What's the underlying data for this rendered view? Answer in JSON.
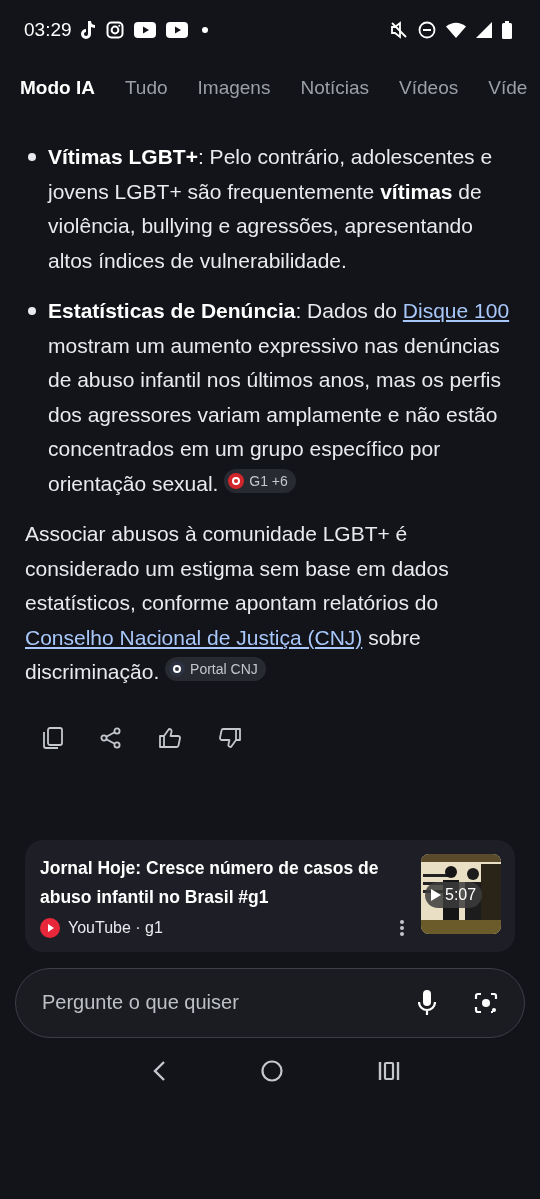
{
  "status_bar": {
    "time": "03:29"
  },
  "tabs": [
    {
      "label": "Modo IA",
      "selected": true
    },
    {
      "label": "Tudo",
      "selected": false
    },
    {
      "label": "Imagens",
      "selected": false
    },
    {
      "label": "Notícias",
      "selected": false
    },
    {
      "label": "Vídeos",
      "selected": false
    },
    {
      "label": "Víde",
      "selected": false
    }
  ],
  "answer": {
    "bullets": [
      {
        "parts": [
          {
            "kind": "text",
            "text": "**Vítimas LGBT+**: Pelo contrário, adolescentes e jovens LGBT+ são frequentemente **vítimas** de violência, bullying e agressões, apresentando altos índices de vulnerabilidade."
          }
        ]
      },
      {
        "parts": [
          {
            "kind": "text",
            "text": "**Estatísticas de Denúncia**: Dados do"
          },
          {
            "kind": "link",
            "text": "Disque 100"
          },
          {
            "kind": "text",
            "text": "mostram um aumento expressivo nas denúncias de abuso infantil nos últimos anos, mas os perfis dos agressores variam amplamente e não estão concentrados em um grupo específico por orientação sexual."
          },
          {
            "kind": "chip",
            "color": "#d3262c",
            "text": "G1 +6"
          }
        ]
      }
    ],
    "paragraph": {
      "parts": [
        {
          "kind": "text",
          "text": "Associar abusos à comunidade LGBT+ é considerado um estigma sem base em dados estatísticos, conforme apontam relatórios do"
        },
        {
          "kind": "link",
          "text": "Conselho Nacional de Justiça (CNJ)"
        },
        {
          "kind": "text",
          "text": "sobre discriminação."
        },
        {
          "kind": "chip",
          "color": "#2b3140",
          "text": "Portal CNJ"
        }
      ]
    }
  },
  "video_card": {
    "title": "Jornal Hoje: Cresce número de casos de abuso infantil no Brasil #g1",
    "source": "YouTube · g1",
    "duration": "5:07"
  },
  "search": {
    "placeholder": "Pergunte o que quiser"
  }
}
